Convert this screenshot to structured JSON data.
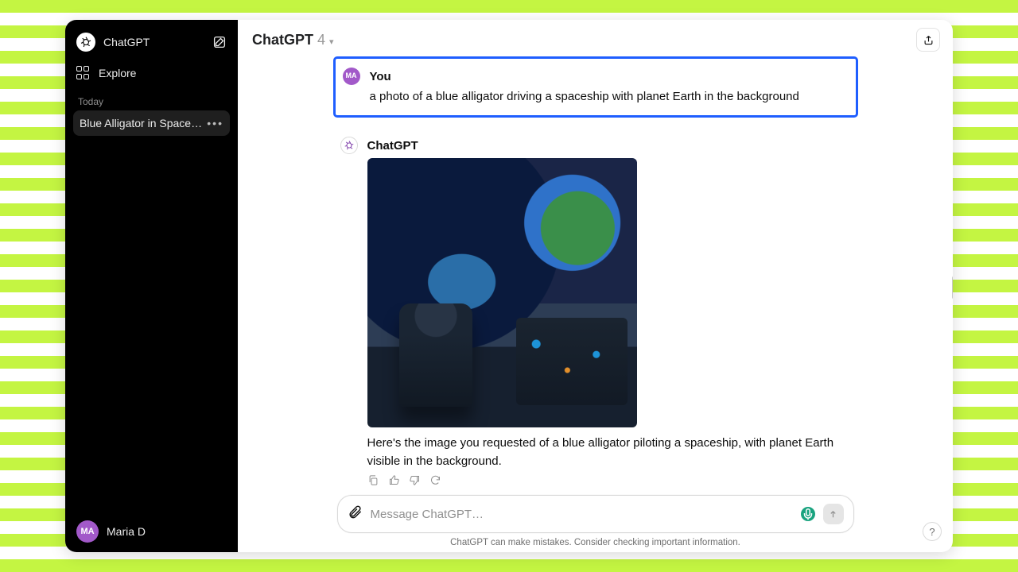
{
  "sidebar": {
    "app_name": "ChatGPT",
    "explore_label": "Explore",
    "sections": [
      {
        "label": "Today",
        "items": [
          {
            "title": "Blue Alligator in Spaceship"
          }
        ]
      }
    ],
    "user": {
      "initials": "MA",
      "name": "Maria D"
    }
  },
  "header": {
    "model_name": "ChatGPT",
    "model_version": "4"
  },
  "conversation": {
    "user": {
      "sender": "You",
      "initials": "MA",
      "text": "a photo of a blue alligator driving a spaceship with planet Earth in the background"
    },
    "assistant": {
      "sender": "ChatGPT",
      "image_alt": "blue alligator piloting a spaceship, Earth visible through cockpit windows",
      "text": "Here's the image you requested of a blue alligator piloting a spaceship, with planet Earth visible in the background."
    }
  },
  "composer": {
    "placeholder": "Message ChatGPT…"
  },
  "footnote": "ChatGPT can make mistakes. Consider checking important information.",
  "help_label": "?",
  "colors": {
    "accent_user_border": "#1f5eff",
    "brand_green": "#19a37f",
    "avatar": "#a259c9"
  }
}
